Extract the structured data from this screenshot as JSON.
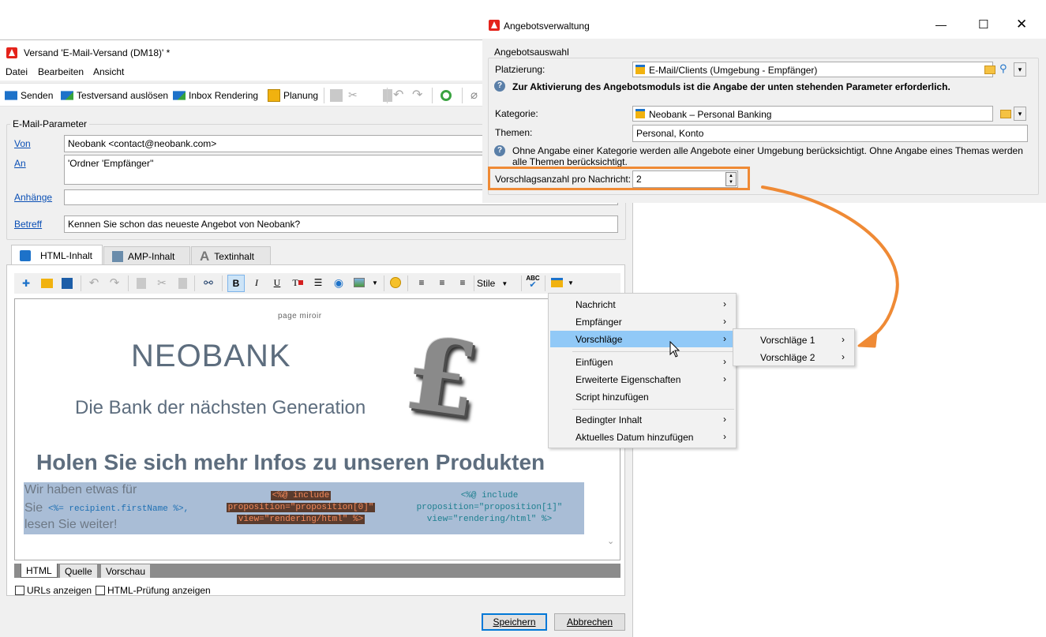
{
  "main_window": {
    "title": "Versand 'E-Mail-Versand (DM18)' *",
    "menu": [
      "Datei",
      "Bearbeiten",
      "Ansicht"
    ],
    "toolbar": {
      "send": "Senden",
      "test_send": "Testversand auslösen",
      "inbox_rendering": "Inbox Rendering",
      "schedule": "Planung"
    },
    "email_params": {
      "group_title": "E-Mail-Parameter",
      "from_label": "Von",
      "from_value": "Neobank <contact@neobank.com>",
      "to_label": "An",
      "to_value": "'Ordner 'Empfänger''",
      "attachments_label": "Anhänge",
      "attachments_value": "",
      "subject_label": "Betreff",
      "subject_value": "Kennen Sie schon das neueste Angebot von Neobank?"
    },
    "content_tabs": [
      "HTML-Inhalt",
      "AMP-Inhalt",
      "Textinhalt"
    ],
    "editor_toolbar": {
      "styles_label": "Stile"
    },
    "editor_content": {
      "mirror_page": "page miroir",
      "brand": "NEOBANK",
      "tagline": "Die Bank der nächsten Generation",
      "headline": "Holen Sie sich mehr Infos zu unseren Produkten",
      "intro_line1": "Wir haben etwas für",
      "intro_line2_prefix": "Sie ",
      "intro_code": "<%= recipient.firstName %>,",
      "intro_line3": "lesen Sie weiter!",
      "prop0_line1": "<%@ include",
      "prop0_line2": "proposition=\"proposition[0]\"",
      "prop0_line3": "view=\"rendering/html\" %>",
      "prop1_line1": "<%@ include",
      "prop1_line2": "proposition=\"proposition[1]\"",
      "prop1_line3": "view=\"rendering/html\" %>"
    },
    "bottom_tabs": [
      "HTML",
      "Quelle",
      "Vorschau"
    ],
    "options": {
      "show_urls": "URLs anzeigen",
      "html_check": "HTML-Prüfung anzeigen"
    },
    "buttons": {
      "save": "Speichern",
      "cancel": "Abbrechen"
    }
  },
  "dialog": {
    "title": "Angebotsverwaltung",
    "group_title": "Angebotsauswahl",
    "placement_label": "Platzierung:",
    "placement_value": "E-Mail/Clients (Umgebung - Empfänger)",
    "info_required": "Zur Aktivierung des Angebotsmoduls ist die Angabe der unten stehenden Parameter erforderlich.",
    "category_label": "Kategorie:",
    "category_value": "Neobank – Personal Banking",
    "themes_label": "Themen:",
    "themes_value": "Personal, Konto",
    "info_optional": "Ohne Angabe einer Kategorie werden alle Angebote einer Umgebung berücksichtigt. Ohne Angabe eines Themas werden alle Themen berücksichtigt.",
    "count_label": "Vorschlagsanzahl pro Nachricht:",
    "count_value": "2"
  },
  "context_menu": {
    "items": [
      "Nachricht",
      "Empfänger",
      "Vorschläge",
      "Einfügen",
      "Erweiterte Eigenschaften",
      "Script hinzufügen",
      "Bedingter Inhalt",
      "Aktuelles Datum hinzufügen"
    ],
    "highlighted": "Vorschläge",
    "submenu": [
      "Vorschläge 1",
      "Vorschläge 2"
    ]
  },
  "colors": {
    "highlight_box": "#ef8a35",
    "arrow": "#ef8a35",
    "menu_highlight": "#91c9f7",
    "brand_text": "#5d6d7e",
    "selection": "#a9bdd6"
  }
}
